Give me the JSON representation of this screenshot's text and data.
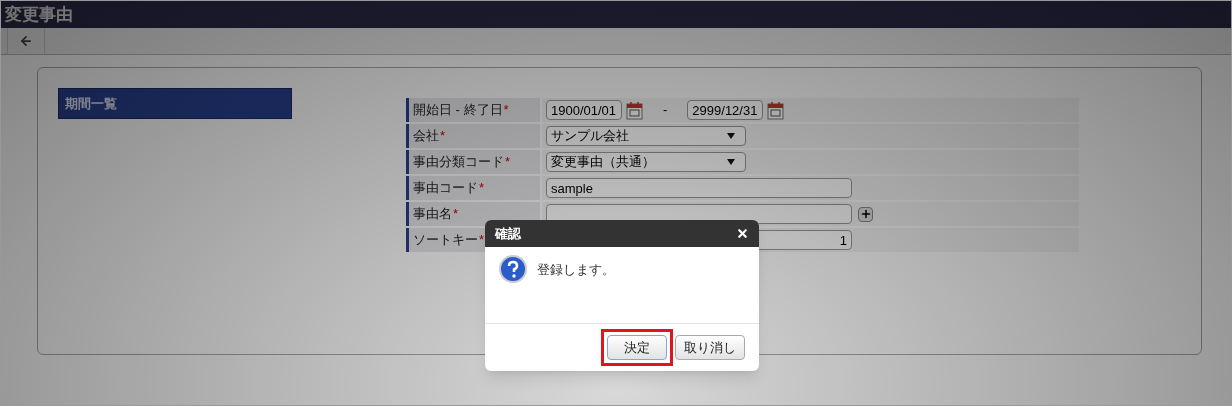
{
  "app": {
    "title": "変更事由"
  },
  "sidebar": {
    "items": [
      {
        "label": "期間一覧",
        "selected": true
      }
    ]
  },
  "form": {
    "rows": [
      {
        "kind": "date_range",
        "label": "開始日 - 終了日",
        "required": "*",
        "from": "1900/01/01",
        "separator": "-",
        "to": "2999/12/31"
      },
      {
        "kind": "select",
        "label": "会社",
        "required": "*",
        "value": "サンプル会社"
      },
      {
        "kind": "select",
        "label": "事由分類コード",
        "required": "*",
        "value": "変更事由（共通）"
      },
      {
        "kind": "text",
        "label": "事由コード",
        "required": "*",
        "value": "sample"
      },
      {
        "kind": "text_plus",
        "label": "事由名",
        "required": "*"
      },
      {
        "kind": "number",
        "label": "ソートキー",
        "required": "*",
        "value": "1"
      }
    ]
  },
  "dialog": {
    "title": "確認",
    "message": "登録します。",
    "buttons": [
      {
        "label": "決定",
        "highlighted": true
      },
      {
        "label": "取り消し",
        "highlighted": false
      }
    ]
  }
}
